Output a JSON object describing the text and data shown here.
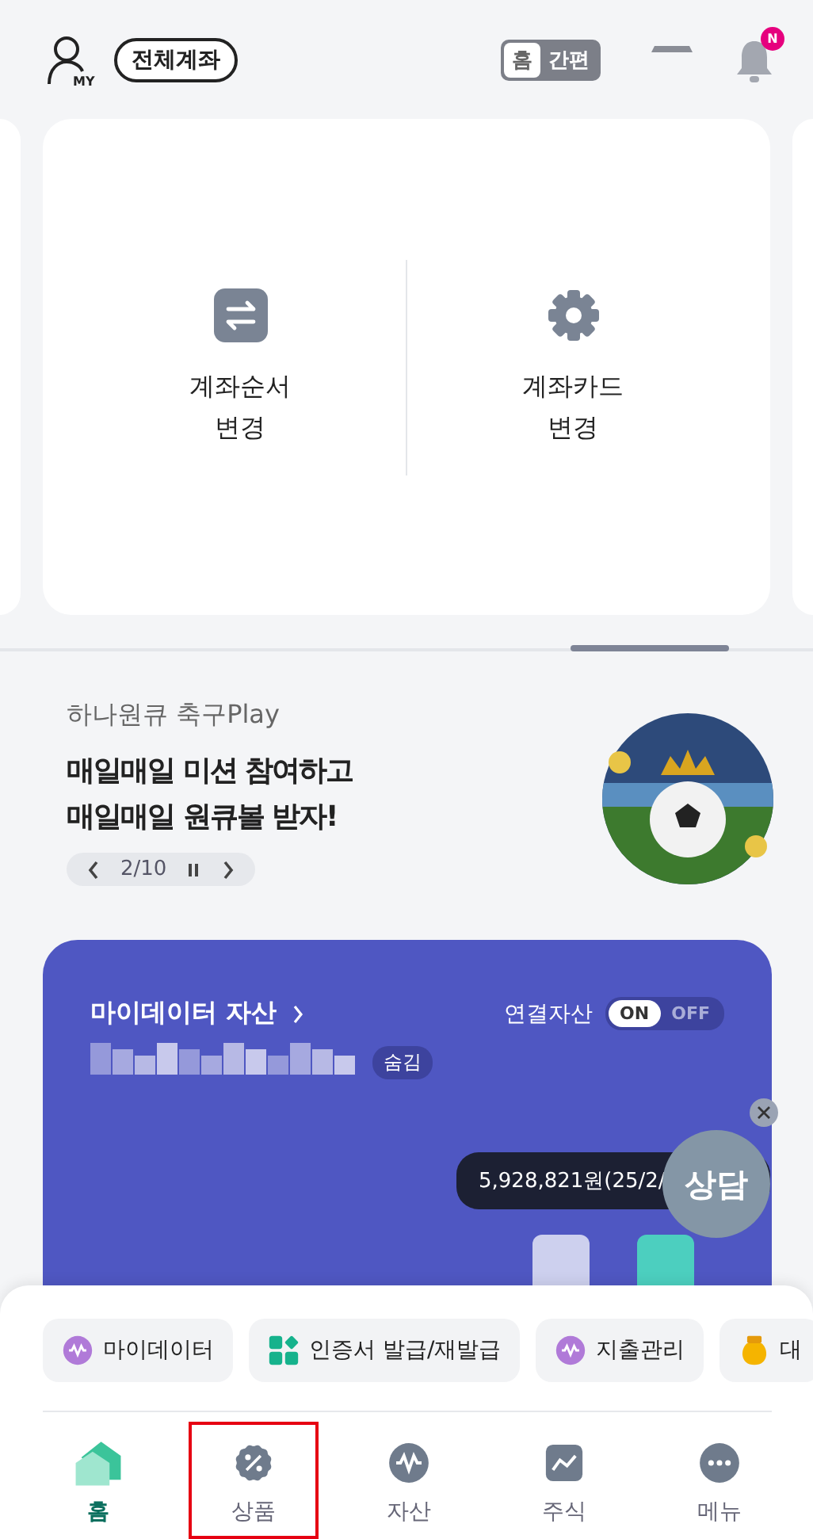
{
  "header": {
    "my_label": "MY",
    "all_accounts": "전체계좌",
    "mode_toggle": [
      {
        "label": "홈",
        "selected": true
      },
      {
        "label": "간편",
        "selected": false
      }
    ],
    "notification_badge": "N"
  },
  "shortcuts": [
    {
      "kind": "swap",
      "lines": [
        "계좌순서",
        "변경"
      ]
    },
    {
      "kind": "gear",
      "lines": [
        "계좌카드",
        "변경"
      ]
    }
  ],
  "banner": {
    "subtitle": "하나원큐 축구Play",
    "title_lines": [
      "매일매일 미션 참여하고",
      "매일매일 원큐볼 받자!"
    ],
    "pager": "2/10"
  },
  "mydata": {
    "title": "마이데이터 자산",
    "toggle_label": "연결자산",
    "toggle": [
      {
        "label": "ON",
        "selected": true
      },
      {
        "label": "OFF",
        "selected": false
      }
    ],
    "hide_label": "숨김",
    "tooltip": "5,928,821원(25/2/"
  },
  "consult_button": "상담",
  "quick_menu": [
    {
      "kind": "won",
      "label": "마이데이터"
    },
    {
      "kind": "blocks",
      "label": "인증서 발급/재발급"
    },
    {
      "kind": "won",
      "label": "지출관리"
    },
    {
      "kind": "pouch",
      "label": "대"
    }
  ],
  "nav": [
    {
      "kind": "home",
      "label": "홈",
      "selected": true,
      "highlighted": false
    },
    {
      "kind": "percent",
      "label": "상품",
      "selected": false,
      "highlighted": true
    },
    {
      "kind": "won",
      "label": "자산",
      "selected": false,
      "highlighted": false
    },
    {
      "kind": "chart",
      "label": "주식",
      "selected": false,
      "highlighted": false
    },
    {
      "kind": "more",
      "label": "메뉴",
      "selected": false,
      "highlighted": false
    }
  ]
}
